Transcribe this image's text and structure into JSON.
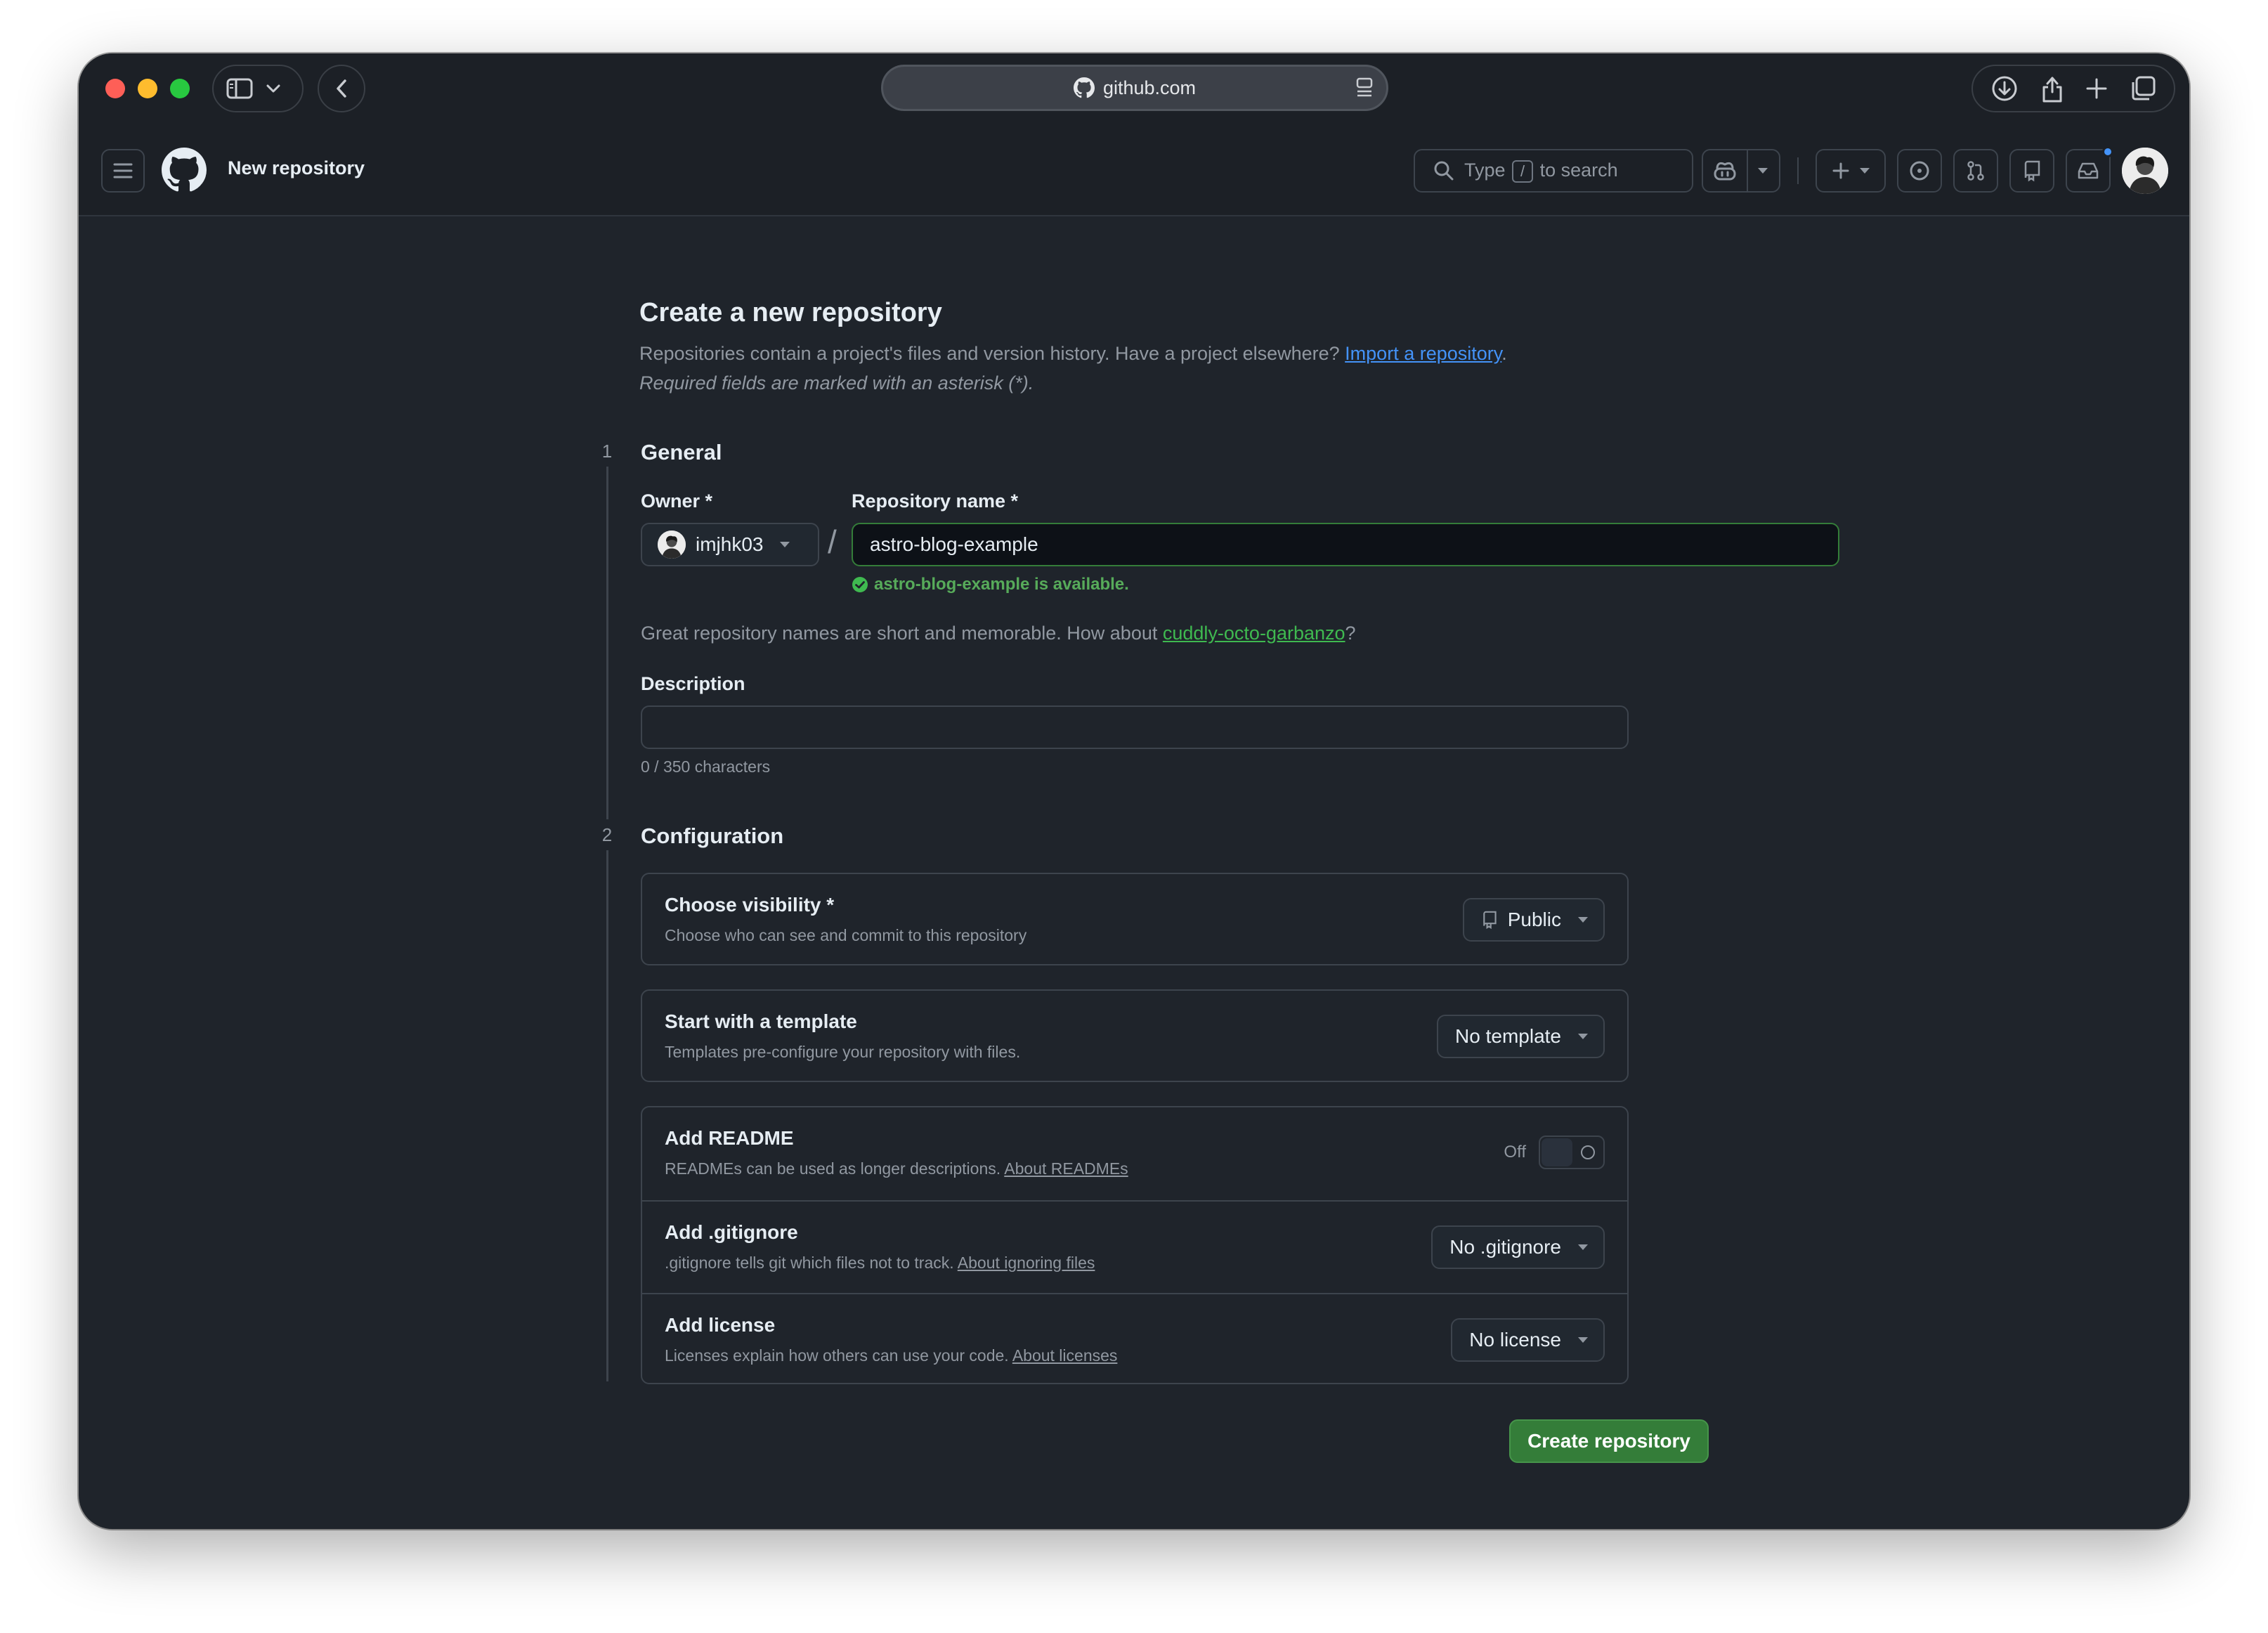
{
  "browser": {
    "url": "github.com"
  },
  "header": {
    "page_context": "New repository",
    "search_prefix": "Type",
    "search_key": "/",
    "search_suffix": "to search"
  },
  "page": {
    "title": "Create a new repository",
    "description": "Repositories contain a project's files and version history. Have a project elsewhere?",
    "import_link": "Import a repository",
    "description_end": ".",
    "required_note": "Required fields are marked with an asterisk (*)."
  },
  "general": {
    "step": "1",
    "title": "General",
    "owner_label": "Owner *",
    "owner_value": "imjhk03",
    "repo_label": "Repository name *",
    "repo_value": "astro-blog-example",
    "available_msg": "astro-blog-example is available.",
    "suggestion_prefix": "Great repository names are short and memorable. How about",
    "suggestion_name": "cuddly-octo-garbanzo",
    "suggestion_suffix": "?",
    "description_label": "Description",
    "description_value": "",
    "char_count": "0 / 350 characters"
  },
  "configuration": {
    "step": "2",
    "title": "Configuration",
    "visibility": {
      "title": "Choose visibility *",
      "desc": "Choose who can see and commit to this repository",
      "value": "Public"
    },
    "template": {
      "title": "Start with a template",
      "desc": "Templates pre-configure your repository with files.",
      "value": "No template"
    },
    "readme": {
      "title": "Add README",
      "desc": "READMEs can be used as longer descriptions.",
      "link": "About READMEs",
      "toggle_label": "Off"
    },
    "gitignore": {
      "title": "Add .gitignore",
      "desc": ".gitignore tells git which files not to track.",
      "link": "About ignoring files",
      "value": "No .gitignore"
    },
    "license": {
      "title": "Add license",
      "desc": "Licenses explain how others can use your code.",
      "link": "About licenses",
      "value": "No license"
    }
  },
  "actions": {
    "create_label": "Create repository"
  },
  "colors": {
    "bg": "#1f242b",
    "border": "#3d444d",
    "muted": "#9198a1",
    "link": "#4493f8",
    "success": "#3fb950",
    "primary_button": "#347d39"
  }
}
